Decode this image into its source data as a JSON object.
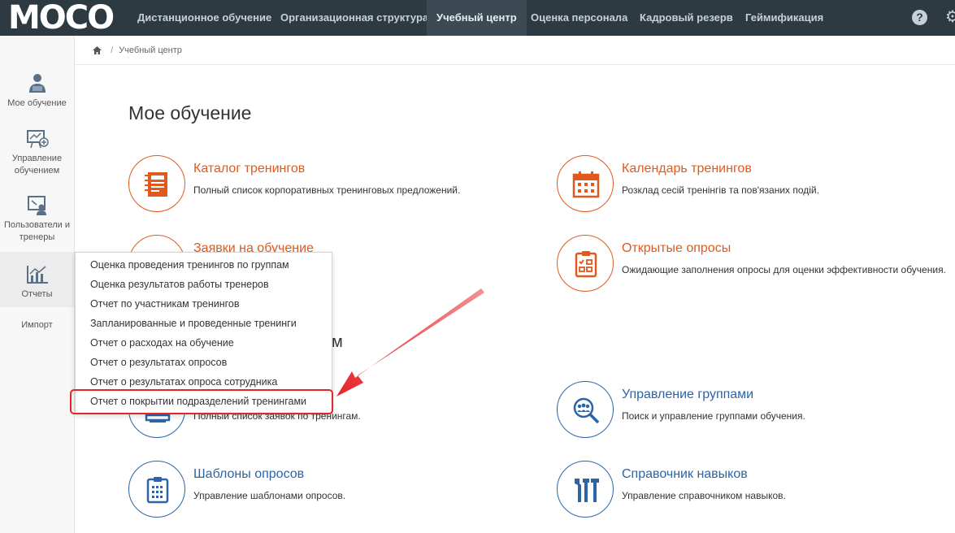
{
  "brand": {
    "logo_text": "MOCO"
  },
  "topnav": {
    "items": [
      {
        "label": "Дистанционное обучение"
      },
      {
        "label": "Организационная структура"
      },
      {
        "label": "Учебный центр"
      },
      {
        "label": "Оценка персонала"
      },
      {
        "label": "Кадровый резерв"
      },
      {
        "label": "Геймификация"
      }
    ],
    "active_index": 2,
    "help_glyph": "?",
    "gear_glyph": "⚙"
  },
  "sidebar": {
    "items": [
      {
        "label": "Мое обучение",
        "icon": "student-icon"
      },
      {
        "label": "Управление обучением",
        "icon": "presentation-icon"
      },
      {
        "label": "Пользователи и тренеры",
        "icon": "user-board-icon"
      },
      {
        "label": "Отчеты",
        "icon": "chart-icon"
      },
      {
        "label": "Импорт",
        "icon": ""
      }
    ],
    "active_index": 3
  },
  "breadcrumb": {
    "current": "Учебный центр",
    "separator": "/"
  },
  "main": {
    "title": "Мое обучение",
    "section2_title_fragment": "м",
    "tiles": [
      {
        "title": "Каталог тренингов",
        "desc": "Полный список корпоративных тренинговых предложений.",
        "color": "orange",
        "icon": "catalog-icon"
      },
      {
        "title": "Календарь тренингов",
        "desc": "Розклад сесій тренінгів та пов'язаних подій.",
        "color": "orange",
        "icon": "calendar-icon"
      },
      {
        "title": "Заявки на обучение",
        "desc": "",
        "color": "orange",
        "icon": "requests-icon"
      },
      {
        "title": "Открытые опросы",
        "desc": "Ожидающие заполнения опросы для оценки эффективности обучения.",
        "color": "orange",
        "icon": "survey-icon"
      },
      {
        "title": "",
        "desc": "Полный список заявок по тренингам.",
        "color": "blue",
        "icon": "requests-list-icon"
      },
      {
        "title": "Управление группами",
        "desc": "Поиск и управление группами обучения.",
        "color": "blue",
        "icon": "group-search-icon"
      },
      {
        "title": "Шаблоны опросов",
        "desc": "Управление шаблонами опросов.",
        "color": "blue",
        "icon": "clipboard-icon"
      },
      {
        "title": "Справочник навыков",
        "desc": "Управление справочником навыков.",
        "color": "blue",
        "icon": "tools-icon"
      }
    ]
  },
  "reports_menu": {
    "items": [
      "Оценка проведения тренингов по группам",
      "Оценка результатов работы тренеров",
      "Отчет по участникам тренингов",
      "Запланированные и проведенные тренинги",
      "Отчет о расходах на обучение",
      "Отчет о результатах опросов",
      "Отчет о результатах опроса сотрудника",
      "Отчет о покрытии подразделений тренингами"
    ],
    "highlighted_index": 7
  },
  "colors": {
    "topbar": "#2d3a42",
    "orange": "#e05a1e",
    "blue": "#2b64a8",
    "annotation_red": "#e5252a"
  }
}
